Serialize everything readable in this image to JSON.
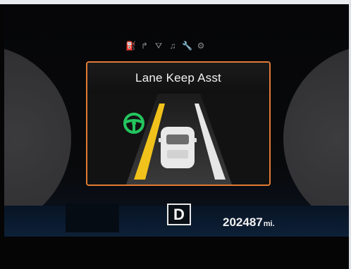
{
  "header_icons": [
    {
      "name": "fuel-display-icon",
      "glyph": "⛽"
    },
    {
      "name": "turn-arrow-icon",
      "glyph": "↱"
    },
    {
      "name": "road-icon",
      "glyph": "⛛"
    },
    {
      "name": "music-note-icon",
      "glyph": "♫"
    },
    {
      "name": "wrench-icon",
      "glyph": "🔧"
    },
    {
      "name": "gear-icon",
      "glyph": "⚙"
    }
  ],
  "panel": {
    "title": "Lane Keep Asst",
    "border_color": "#e07b34",
    "status_color": "#23c55e"
  },
  "gear": {
    "label": "D"
  },
  "odometer": {
    "value": "202487",
    "unit": "mi."
  }
}
